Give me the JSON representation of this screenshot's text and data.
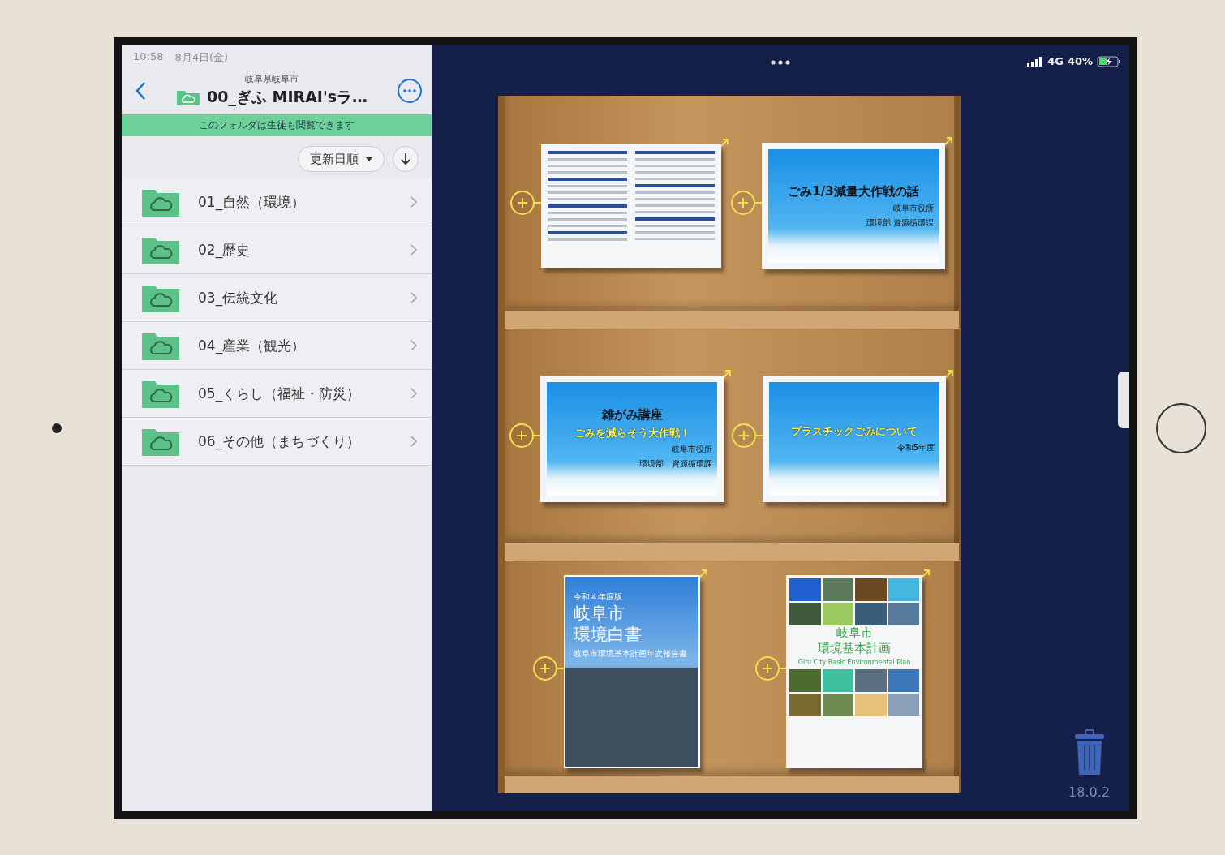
{
  "status_bar": {
    "time": "10:58",
    "date": "8月4日(金)",
    "network": "4G",
    "battery": "40%"
  },
  "sidebar": {
    "breadcrumb": "岐阜県岐阜市",
    "title": "00_ぎふ MIRAI'sラ…",
    "banner": "このフォルダは生徒も閲覧できます",
    "sort": "更新日順",
    "folders": [
      {
        "label": "01_自然（環境）"
      },
      {
        "label": "02_歴史"
      },
      {
        "label": "03_伝統文化"
      },
      {
        "label": "04_産業（観光）"
      },
      {
        "label": "05_くらし（福祉・防災）"
      },
      {
        "label": "06_その他（まちづくり）"
      }
    ]
  },
  "shelf": {
    "items": [
      {
        "kind": "report"
      },
      {
        "kind": "slide",
        "title": "ごみ1/3減量大作戦の話",
        "lines": [
          "岐阜市役所",
          "環境部 資源循環課"
        ]
      },
      {
        "kind": "slide",
        "title": "雑がみ講座",
        "subtitle": "ごみを減らそう大作戦！",
        "lines": [
          "岐阜市役所",
          "環境部　資源循環課"
        ]
      },
      {
        "kind": "slide",
        "subtitle": "プラスチックごみについて",
        "lines": [
          "令和5年度"
        ]
      },
      {
        "kind": "photo-cover",
        "edition": "令和４年度版",
        "title": [
          "岐阜市",
          "環境白書"
        ],
        "note": "岐阜市環境基本計画年次報告書"
      },
      {
        "kind": "grid-cover",
        "title": [
          "岐阜市",
          "環境基本計画"
        ],
        "note": "Gifu City Basic Environmental Plan"
      }
    ]
  },
  "version": "18.0.2"
}
